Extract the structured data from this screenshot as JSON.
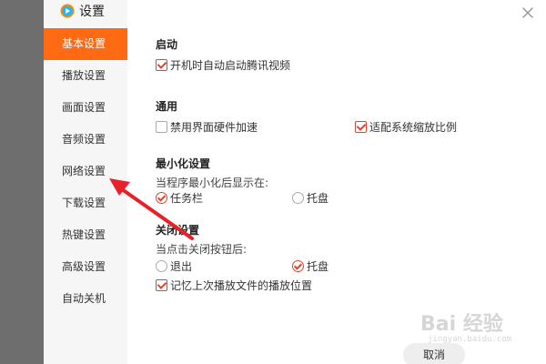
{
  "window": {
    "title": "设置"
  },
  "sidebar": {
    "items": [
      {
        "label": "基本设置",
        "active": true
      },
      {
        "label": "播放设置"
      },
      {
        "label": "画面设置"
      },
      {
        "label": "音频设置"
      },
      {
        "label": "网络设置"
      },
      {
        "label": "下载设置"
      },
      {
        "label": "热键设置"
      },
      {
        "label": "高级设置"
      },
      {
        "label": "自动关机"
      }
    ]
  },
  "main": {
    "startup": {
      "title": "启动",
      "auto_start": {
        "label": "开机时自动启动腾讯视频",
        "checked": true
      }
    },
    "general": {
      "title": "通用",
      "disable_hw": {
        "label": "禁用界面硬件加速",
        "checked": false
      },
      "fit_scale": {
        "label": "适配系统缩放比例",
        "checked": true
      }
    },
    "minimize": {
      "title": "最小化设置",
      "prompt": "当程序最小化后显示在:",
      "taskbar": {
        "label": "任务栏",
        "selected": true
      },
      "tray": {
        "label": "托盘",
        "selected": false
      }
    },
    "close": {
      "title": "关闭设置",
      "prompt": "当点击关闭按钮后:",
      "exit": {
        "label": "退出",
        "selected": false
      },
      "tray": {
        "label": "托盘",
        "selected": true
      },
      "remember": {
        "label": "记忆上次播放文件的播放位置",
        "checked": true
      }
    }
  },
  "footer": {
    "cancel_label": "取消"
  },
  "watermark": {
    "text": "Bai 经验",
    "sub": "jingyan.baidu.com"
  },
  "colors": {
    "accent": "#ff6a13",
    "check": "#e2432c",
    "arrow": "#e8202a"
  }
}
